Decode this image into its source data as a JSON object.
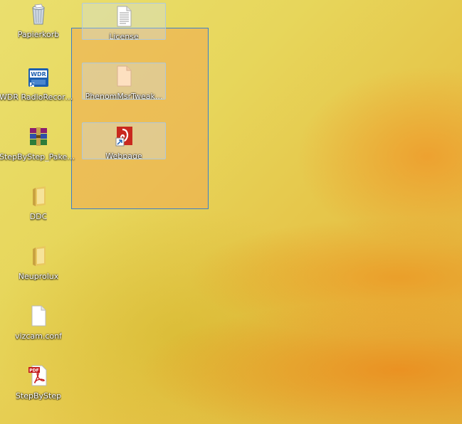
{
  "desktop": {
    "left_column": [
      {
        "label": "Papierkorb",
        "icon": "recycle-bin-icon"
      },
      {
        "label": "WDR RadioRecorder",
        "icon": "wdr-radiorecorder-icon",
        "badge": "WDR"
      },
      {
        "label": "StepByStep_Paket_...",
        "icon": "winrar-archive-icon"
      },
      {
        "label": "DDC",
        "icon": "folder-icon"
      },
      {
        "label": "Neuprolux",
        "icon": "folder-icon"
      },
      {
        "label": "vizcam.conf",
        "icon": "blank-file-icon"
      },
      {
        "label": "StepByStep",
        "icon": "pdf-file-icon",
        "badge": "PDF"
      }
    ],
    "selected_items": [
      {
        "label": "License",
        "icon": "text-document-icon"
      },
      {
        "label": "PhenomMsrTweak...",
        "icon": "blank-file-icon"
      },
      {
        "label": "Webpage",
        "icon": "webpage-shortcut-icon"
      }
    ]
  },
  "colors": {
    "selection_border": "#3c7fc8",
    "selection_fill": "#eeaa50"
  }
}
